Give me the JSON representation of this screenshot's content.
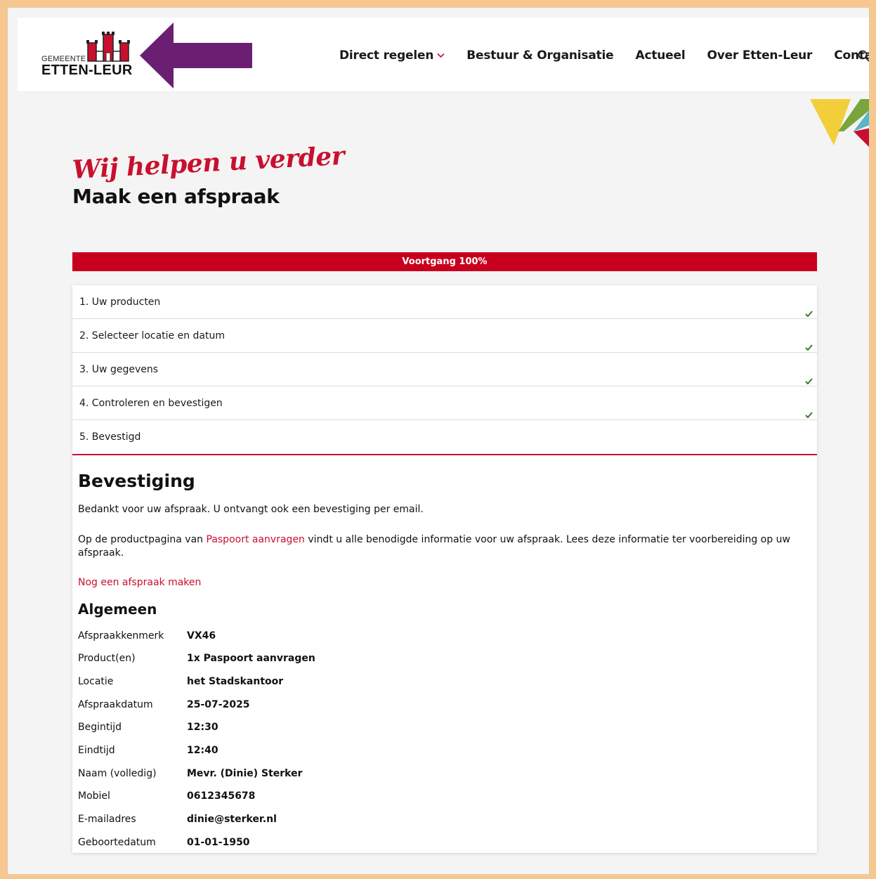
{
  "header": {
    "logo_small": "GEMEENTE",
    "logo_big": "ETTEN-LEUR",
    "nav": [
      {
        "label": "Direct regelen"
      },
      {
        "label": "Bestuur & Organisatie"
      },
      {
        "label": "Actueel"
      },
      {
        "label": "Over Etten-Leur"
      },
      {
        "label": "Contact"
      }
    ],
    "icons": {
      "dropdown": "chevron-down-icon",
      "search": "search-icon",
      "arrow": "arrow-left-icon"
    }
  },
  "hero": {
    "script_title": "Wij helpen u verder",
    "title": "Maak een afspraak"
  },
  "progress": {
    "label": "Voortgang 100%",
    "value": 100
  },
  "steps": [
    {
      "label": "1. Uw producten",
      "completed": true
    },
    {
      "label": "2. Selecteer locatie en datum",
      "completed": true
    },
    {
      "label": "3. Uw gegevens",
      "completed": true
    },
    {
      "label": "4. Controleren en bevestigen",
      "completed": true
    },
    {
      "label": "5. Bevestigd",
      "completed": false
    }
  ],
  "confirmation": {
    "heading": "Bevestiging",
    "thanks": "Bedankt voor uw afspraak. U ontvangt ook een bevestiging per email.",
    "info_before": "Op de productpagina van ",
    "info_link": "Paspoort aanvragen",
    "info_after": " vindt u alle benodigde informatie voor uw afspraak. Lees deze informatie ter voorbereiding op uw afspraak.",
    "new_appointment_link": "Nog een afspraak maken"
  },
  "general": {
    "heading": "Algemeen",
    "rows": [
      {
        "label": "Afspraakkenmerk",
        "value": "VX46"
      },
      {
        "label": "Product(en)",
        "value": "1x Paspoort aanvragen"
      },
      {
        "label": "Locatie",
        "value": "het Stadskantoor"
      },
      {
        "label": "Afspraakdatum",
        "value": "25-07-2025"
      },
      {
        "label": "Begintijd",
        "value": "12:30"
      },
      {
        "label": "Eindtijd",
        "value": "12:40"
      },
      {
        "label": "Naam (volledig)",
        "value": "Mevr. (Dinie) Sterker"
      },
      {
        "label": "Mobiel",
        "value": "0612345678"
      },
      {
        "label": "E-mailadres",
        "value": "dinie@sterker.nl"
      },
      {
        "label": "Geboortedatum",
        "value": "01-01-1950"
      }
    ]
  },
  "colors": {
    "brand_red": "#c8001e",
    "arrow_purple": "#6b1f72",
    "frame_orange": "#f6c890",
    "check_green": "#3a7a2a"
  }
}
